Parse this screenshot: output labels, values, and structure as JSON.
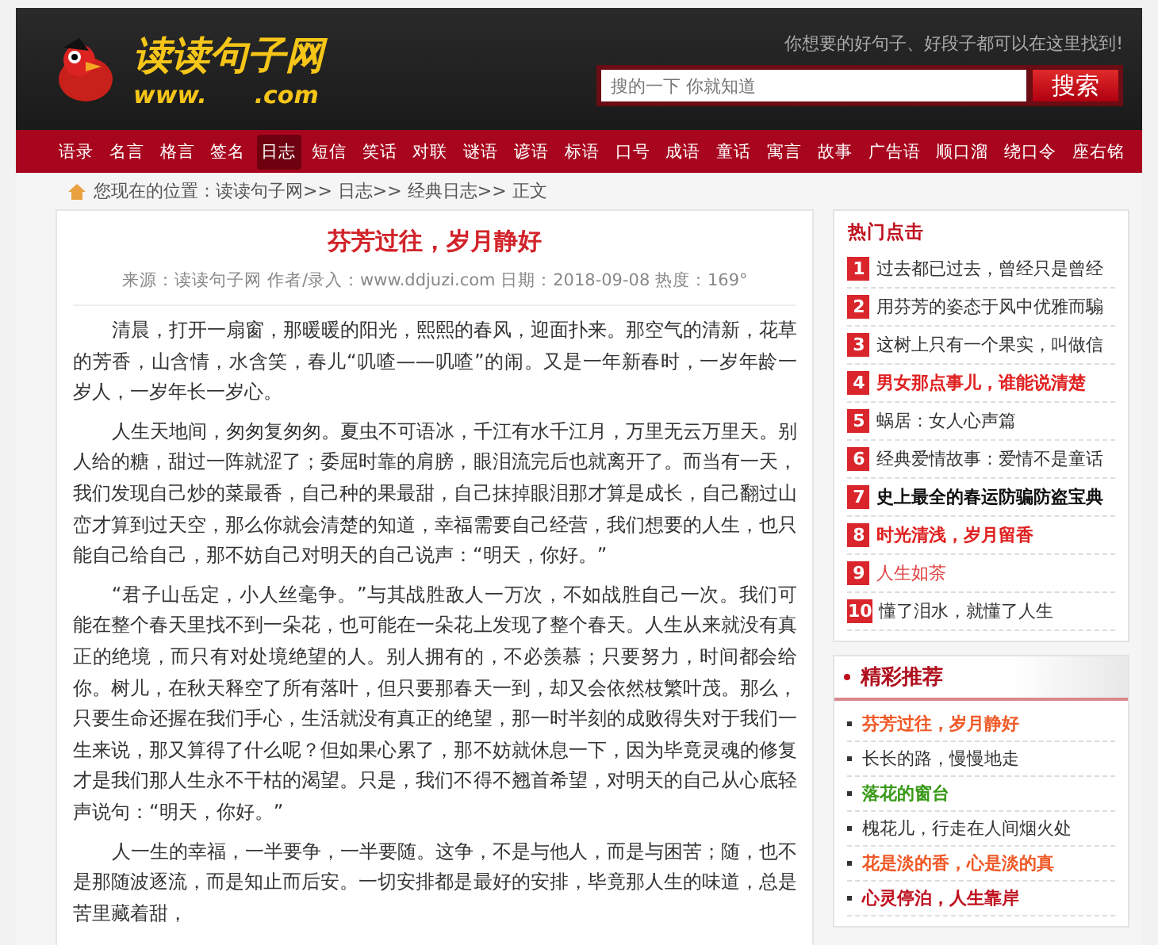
{
  "header": {
    "logo_title": "读读句子网",
    "logo_url_start": "www.",
    "logo_url_end": ".com",
    "slogan": "你想要的好句子、好段子都可以在这里找到!",
    "search": {
      "placeholder": "搜的一下 你就知道",
      "button": "搜索"
    }
  },
  "nav": [
    {
      "label": "语录",
      "selected": false
    },
    {
      "label": "名言",
      "selected": false
    },
    {
      "label": "格言",
      "selected": false
    },
    {
      "label": "签名",
      "selected": false
    },
    {
      "label": "日志",
      "selected": true
    },
    {
      "label": "短信",
      "selected": false
    },
    {
      "label": "笑话",
      "selected": false
    },
    {
      "label": "对联",
      "selected": false
    },
    {
      "label": "谜语",
      "selected": false
    },
    {
      "label": "谚语",
      "selected": false
    },
    {
      "label": "标语",
      "selected": false
    },
    {
      "label": "口号",
      "selected": false
    },
    {
      "label": "成语",
      "selected": false
    },
    {
      "label": "童话",
      "selected": false
    },
    {
      "label": "寓言",
      "selected": false
    },
    {
      "label": "故事",
      "selected": false
    },
    {
      "label": "广告语",
      "selected": false
    },
    {
      "label": "顺口溜",
      "selected": false
    },
    {
      "label": "绕口令",
      "selected": false
    },
    {
      "label": "座右铭",
      "selected": false
    }
  ],
  "breadcrumb": "您现在的位置：读读句子网>> 日志>> 经典日志>> 正文",
  "article": {
    "title": "芬芳过往，岁月静好",
    "meta": "来源：读读句子网 作者/录入：www.ddjuzi.com 日期：2018-09-08 热度：169°",
    "paragraphs": [
      "清晨，打开一扇窗，那暖暖的阳光，熙熙的春风，迎面扑来。那空气的清新，花草的芳香，山含情，水含笑，春儿“叽喳——叽喳”的闹。又是一年新春时，一岁年龄一岁人，一岁年长一岁心。",
      "人生天地间，匆匆复匆匆。夏虫不可语冰，千江有水千江月，万里无云万里天。别人给的糖，甜过一阵就涩了；委屈时靠的肩膀，眼泪流完后也就离开了。而当有一天，我们发现自己炒的菜最香，自己种的果最甜，自己抹掉眼泪那才算是成长，自己翻过山峦才算到过天空，那么你就会清楚的知道，幸福需要自己经营，我们想要的人生，也只能自己给自己，那不妨自己对明天的自己说声：“明天，你好。”",
      "“君子山岳定，小人丝毫争。”与其战胜敌人一万次，不如战胜自己一次。我们可能在整个春天里找不到一朵花，也可能在一朵花上发现了整个春天。人生从来就没有真正的绝境，而只有对处境绝望的人。别人拥有的，不必羡慕；只要努力，时间都会给你。树儿，在秋天释空了所有落叶，但只要那春天一到，却又会依然枝繁叶茂。那么，只要生命还握在我们手心，生活就没有真正的绝望，那一时半刻的成败得失对于我们一生来说，那又算得了什么呢？但如果心累了，那不妨就休息一下，因为毕竟灵魂的修复才是我们那人生永不干枯的渴望。只是，我们不得不翘首希望，对明天的自己从心底轻声说句：“明天，你好。”",
      "人一生的幸福，一半要争，一半要随。这争，不是与他人，而是与困苦；随，也不是那随波逐流，而是知止而后安。一切安排都是最好的安排，毕竟那人生的味道，总是苦里藏着甜，"
    ]
  },
  "hot": {
    "title": "热门点击",
    "items": [
      {
        "rank": "1",
        "text": "过去都已过去，曾经只是曾经",
        "color": "#333333",
        "bold": false
      },
      {
        "rank": "2",
        "text": "用芬芳的姿态于风中优雅而騸",
        "color": "#333333",
        "bold": false
      },
      {
        "rank": "3",
        "text": "这树上只有一个果实，叫做信",
        "color": "#333333",
        "bold": false
      },
      {
        "rank": "4",
        "text": "男女那点事儿，谁能说清楚",
        "color": "#e02020",
        "bold": true
      },
      {
        "rank": "5",
        "text": "蜗居：女人心声篇",
        "color": "#333333",
        "bold": false
      },
      {
        "rank": "6",
        "text": "经典爱情故事：爱情不是童话",
        "color": "#333333",
        "bold": false
      },
      {
        "rank": "7",
        "text": "史上最全的春运防骗防盗宝典",
        "color": "#111111",
        "bold": true
      },
      {
        "rank": "8",
        "text": "时光清浅，岁月留香",
        "color": "#e02020",
        "bold": true
      },
      {
        "rank": "9",
        "text": "人生如茶",
        "color": "#e04040",
        "bold": false
      },
      {
        "rank": "10",
        "text": "懂了泪水，就懂了人生",
        "color": "#333333",
        "bold": false
      }
    ]
  },
  "recommend": {
    "title": "精彩推荐",
    "items": [
      {
        "text": "芬芳过往，岁月静好",
        "color": "#f05a28",
        "bold": true
      },
      {
        "text": "长长的路，慢慢地走",
        "color": "#333333",
        "bold": false
      },
      {
        "text": "落花的窗台",
        "color": "#3a9a1a",
        "bold": true
      },
      {
        "text": "槐花儿，行走在人间烟火处",
        "color": "#333333",
        "bold": false
      },
      {
        "text": "花是淡的香，心是淡的真",
        "color": "#f05a28",
        "bold": true
      },
      {
        "text": "心灵停泊，人生靠岸",
        "color": "#c01020",
        "bold": true
      }
    ]
  }
}
